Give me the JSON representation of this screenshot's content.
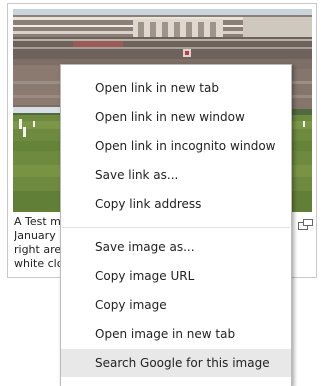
{
  "thumbnail": {
    "caption_lines": [
      "A Test m",
      "January 2",
      "right are",
      "white clo"
    ],
    "enlarge_icon": "expand-window-icon"
  },
  "context_menu": {
    "link_items": [
      {
        "label": "Open link in new tab"
      },
      {
        "label": "Open link in new window"
      },
      {
        "label": "Open link in incognito window"
      },
      {
        "label": "Save link as..."
      },
      {
        "label": "Copy link address"
      }
    ],
    "image_items": [
      {
        "label": "Save image as..."
      },
      {
        "label": "Copy image URL"
      },
      {
        "label": "Copy image"
      },
      {
        "label": "Open image in new tab"
      },
      {
        "label": "Search Google for this image"
      }
    ],
    "highlighted_item": "Search Google for this image",
    "colors": {
      "highlight": "#e8e8e8",
      "border": "#bababa",
      "text": "#222222"
    }
  }
}
